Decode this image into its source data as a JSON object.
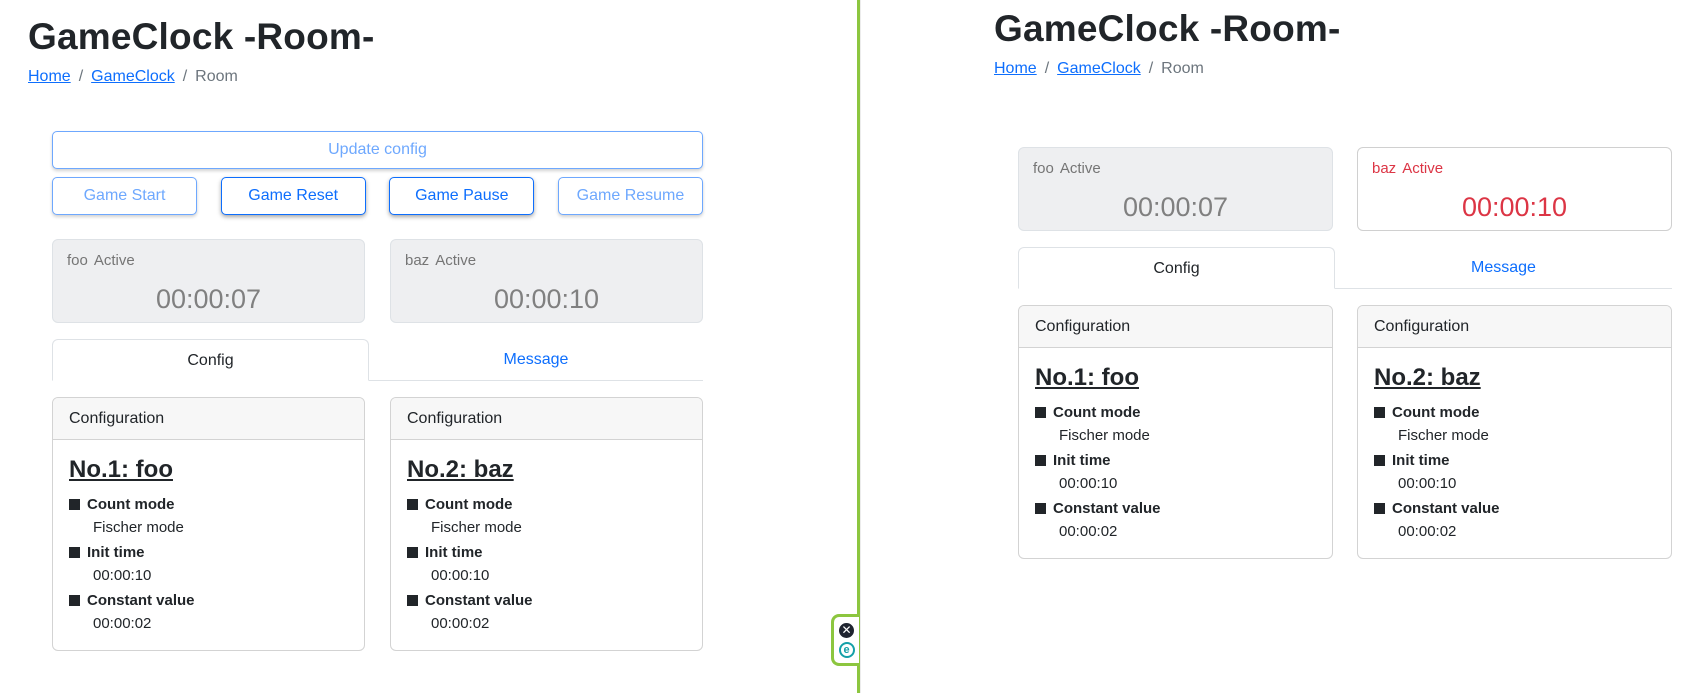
{
  "left": {
    "title": "GameClock -Room-",
    "breadcrumb": [
      {
        "label": "Home",
        "link": true
      },
      {
        "label": "GameClock",
        "link": true
      },
      {
        "label": "Room",
        "link": false
      }
    ],
    "breadcrumb_separator": "/",
    "update_config_label": "Update config",
    "controls": [
      {
        "label": "Game Start",
        "enabled": false
      },
      {
        "label": "Game Reset",
        "enabled": true
      },
      {
        "label": "Game Pause",
        "enabled": true
      },
      {
        "label": "Game Resume",
        "enabled": false
      }
    ],
    "clocks": [
      {
        "name": "foo",
        "status": "Active",
        "time": "00:00:07",
        "highlighted": false
      },
      {
        "name": "baz",
        "status": "Active",
        "time": "00:00:10",
        "highlighted": false
      }
    ],
    "tabs": [
      {
        "label": "Config",
        "active": true
      },
      {
        "label": "Message",
        "active": false
      }
    ],
    "configs": [
      {
        "header": "Configuration",
        "title": "No.1: foo",
        "items": [
          {
            "label": "Count mode",
            "value": "Fischer mode"
          },
          {
            "label": "Init time",
            "value": "00:00:10"
          },
          {
            "label": "Constant value",
            "value": "00:00:02"
          }
        ]
      },
      {
        "header": "Configuration",
        "title": "No.2: baz",
        "items": [
          {
            "label": "Count mode",
            "value": "Fischer mode"
          },
          {
            "label": "Init time",
            "value": "00:00:10"
          },
          {
            "label": "Constant value",
            "value": "00:00:02"
          }
        ]
      }
    ]
  },
  "right": {
    "title": "GameClock -Room-",
    "breadcrumb": [
      {
        "label": "Home",
        "link": true
      },
      {
        "label": "GameClock",
        "link": true
      },
      {
        "label": "Room",
        "link": false
      }
    ],
    "breadcrumb_separator": "/",
    "clocks": [
      {
        "name": "foo",
        "status": "Active",
        "time": "00:00:07",
        "highlighted": false
      },
      {
        "name": "baz",
        "status": "Active",
        "time": "00:00:10",
        "highlighted": true
      }
    ],
    "tabs": [
      {
        "label": "Config",
        "active": true
      },
      {
        "label": "Message",
        "active": false
      }
    ],
    "configs": [
      {
        "header": "Configuration",
        "title": "No.1: foo",
        "items": [
          {
            "label": "Count mode",
            "value": "Fischer mode"
          },
          {
            "label": "Init time",
            "value": "00:00:10"
          },
          {
            "label": "Constant value",
            "value": "00:00:02"
          }
        ]
      },
      {
        "header": "Configuration",
        "title": "No.2: baz",
        "items": [
          {
            "label": "Count mode",
            "value": "Fischer mode"
          },
          {
            "label": "Init time",
            "value": "00:00:10"
          },
          {
            "label": "Constant value",
            "value": "00:00:02"
          }
        ]
      }
    ]
  },
  "extension_widget": {
    "icons": [
      "close-circle-icon",
      "eset-e-icon"
    ],
    "close_glyph": "✕",
    "e_glyph": "e"
  },
  "colors": {
    "primary": "#0d6efd",
    "primary_light": "#6ea8fe",
    "danger": "#dc3545",
    "divider": "#8cc63f"
  }
}
